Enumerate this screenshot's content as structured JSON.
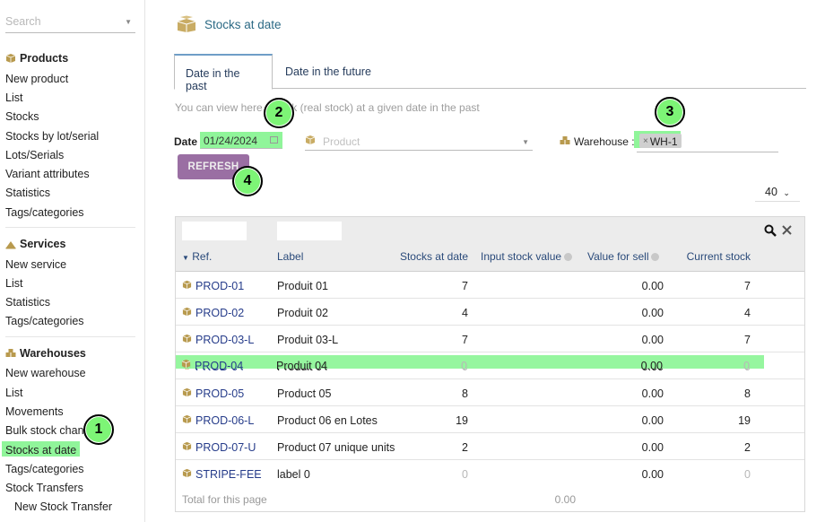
{
  "sidebar": {
    "search_placeholder": "Search",
    "products": {
      "title": "Products",
      "items": [
        "New product",
        "List",
        "Stocks",
        "Stocks by lot/serial",
        "Lots/Serials",
        "Variant attributes",
        "Statistics",
        "Tags/categories"
      ]
    },
    "services": {
      "title": "Services",
      "items": [
        "New service",
        "List",
        "Statistics",
        "Tags/categories"
      ]
    },
    "warehouses": {
      "title": "Warehouses",
      "items": [
        "New warehouse",
        "List",
        "Movements",
        "Bulk stock chang",
        "Stocks at date",
        "Tags/categories",
        "Stock Transfers"
      ],
      "sub_item": "New Stock Transfer"
    }
  },
  "page": {
    "title": "Stocks at date",
    "tabs": [
      "Date in the past",
      "Date in the future"
    ],
    "info": "You can view here        ck (real stock) at a given date in the past"
  },
  "filters": {
    "date_label": "Date",
    "date_value": "01/24/2024",
    "product_placeholder": "Product",
    "warehouse_label": "Warehouse :",
    "warehouse_tag": "WH-1",
    "refresh_label": "REFRESH",
    "limit": "40"
  },
  "table": {
    "columns": {
      "ref": "Ref.",
      "label": "Label",
      "stocks_at_date": "Stocks at date",
      "input_stock_value": "Input stock value",
      "value_for_sell": "Value for sell",
      "current_stock": "Current stock"
    },
    "rows": [
      {
        "ref": "PROD-01",
        "label": "Produit 01",
        "stock": "7",
        "input": "",
        "sell": "0.00",
        "current": "7"
      },
      {
        "ref": "PROD-02",
        "label": "Produit 02",
        "stock": "4",
        "input": "",
        "sell": "0.00",
        "current": "4"
      },
      {
        "ref": "PROD-03-L",
        "label": "Produit 03-L",
        "stock": "7",
        "input": "",
        "sell": "0.00",
        "current": "7"
      },
      {
        "ref": "PROD-04",
        "label": "Produit 04",
        "stock": "0",
        "input": "",
        "sell": "0.00",
        "current": "0"
      },
      {
        "ref": "PROD-05",
        "label": "Product 05",
        "stock": "8",
        "input": "",
        "sell": "0.00",
        "current": "8"
      },
      {
        "ref": "PROD-06-L",
        "label": "Product 06 en Lotes",
        "stock": "19",
        "input": "",
        "sell": "0.00",
        "current": "19"
      },
      {
        "ref": "PROD-07-U",
        "label": "Product 07 unique units",
        "stock": "2",
        "input": "",
        "sell": "0.00",
        "current": "2"
      },
      {
        "ref": "STRIPE-FEE",
        "label": "label 0",
        "stock": "0",
        "input": "",
        "sell": "0.00",
        "current": "0"
      }
    ],
    "footer_label": "Total for this page",
    "footer_value": "0.00"
  },
  "badges": [
    "1",
    "2",
    "3",
    "4"
  ],
  "colors": {
    "highlight": "#90f59a",
    "refresh_button": "#9a6fa3",
    "link": "#263c8a"
  }
}
